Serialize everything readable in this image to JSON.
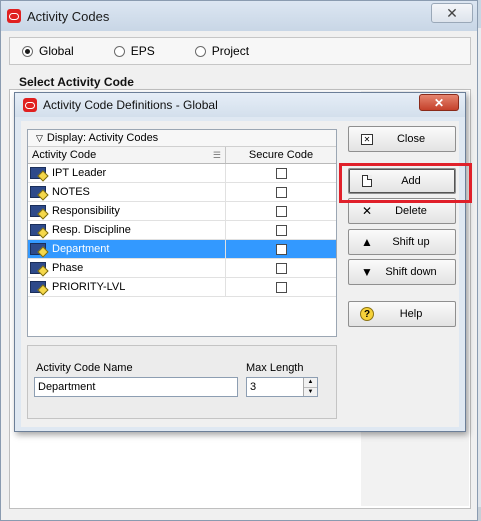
{
  "outer": {
    "title": "Activity Codes",
    "close_symbol": "✕",
    "scope_options": [
      {
        "label": "Global",
        "selected": true
      },
      {
        "label": "EPS",
        "selected": false
      },
      {
        "label": "Project",
        "selected": false
      }
    ],
    "select_label": "Select Activity Code"
  },
  "dialog": {
    "title": "Activity Code Definitions - Global",
    "close_symbol": "✕",
    "display_label": "Display: Activity Codes",
    "columns": {
      "code": "Activity Code",
      "secure": "Secure Code"
    },
    "rows": [
      {
        "label": "IPT Leader",
        "secure": false,
        "selected": false
      },
      {
        "label": "NOTES",
        "secure": false,
        "selected": false
      },
      {
        "label": "Responsibility",
        "secure": false,
        "selected": false
      },
      {
        "label": "Resp. Discipline",
        "secure": false,
        "selected": false
      },
      {
        "label": "Department",
        "secure": false,
        "selected": true
      },
      {
        "label": "Phase",
        "secure": false,
        "selected": false
      },
      {
        "label": "PRIORITY-LVL",
        "secure": false,
        "selected": false
      }
    ],
    "name_label": "Activity Code Name",
    "name_value": "Department",
    "maxlen_label": "Max Length",
    "maxlen_value": "3",
    "buttons": {
      "close": "Close",
      "add": "Add",
      "delete": "Delete",
      "shift_up": "Shift up",
      "shift_down": "Shift down",
      "help": "Help"
    }
  },
  "highlight_color": "#e0202a",
  "selection_color": "#3399ff"
}
